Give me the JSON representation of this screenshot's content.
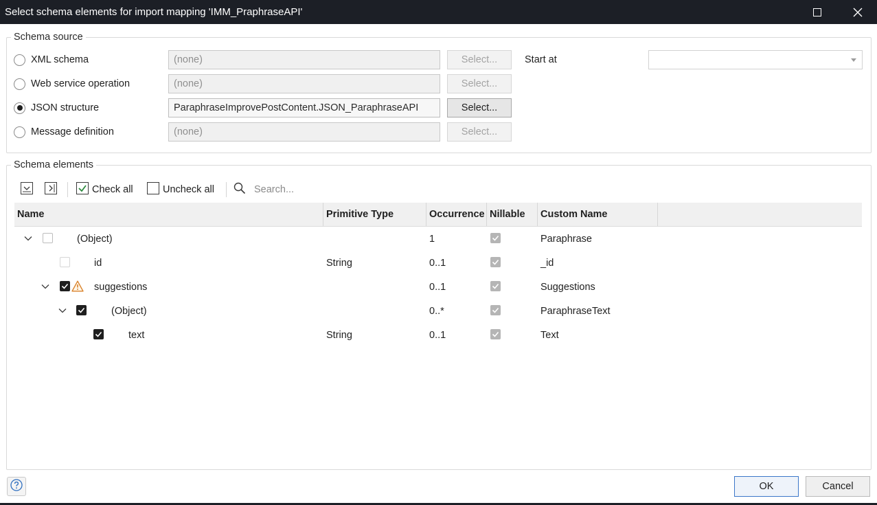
{
  "window": {
    "title": "Select schema elements for import mapping 'IMM_PraphraseAPI'"
  },
  "schema_source": {
    "legend": "Schema source",
    "options": [
      {
        "label": "XML schema",
        "value": "(none)",
        "button": "Select...",
        "selected": false
      },
      {
        "label": "Web service operation",
        "value": "(none)",
        "button": "Select...",
        "selected": false
      },
      {
        "label": "JSON structure",
        "value": "ParaphraseImprovePostContent.JSON_ParaphraseAPI",
        "button": "Select...",
        "selected": true
      },
      {
        "label": "Message definition",
        "value": "(none)",
        "button": "Select...",
        "selected": false
      }
    ],
    "start_at_label": "Start at",
    "start_at_value": ""
  },
  "schema_elements": {
    "legend": "Schema elements",
    "toolbar": {
      "check_all": "Check all",
      "uncheck_all": "Uncheck all",
      "search_placeholder": "Search..."
    },
    "columns": [
      "Name",
      "Primitive Type",
      "Occurrence",
      "Nillable",
      "Custom Name"
    ],
    "rows": [
      {
        "level": 0,
        "expanded": true,
        "checked": false,
        "warning": false,
        "name": "(Object)",
        "type": "",
        "occurrence": "1",
        "nillable": true,
        "custom_name": "Paraphrase"
      },
      {
        "level": 1,
        "expanded": null,
        "checked": false,
        "warning": false,
        "name": "id",
        "type": "String",
        "occurrence": "0..1",
        "nillable": true,
        "custom_name": "_id"
      },
      {
        "level": 1,
        "expanded": true,
        "checked": true,
        "warning": true,
        "name": "suggestions",
        "type": "",
        "occurrence": "0..1",
        "nillable": true,
        "custom_name": "Suggestions"
      },
      {
        "level": 2,
        "expanded": true,
        "checked": true,
        "warning": false,
        "name": "(Object)",
        "type": "",
        "occurrence": "0..*",
        "nillable": true,
        "custom_name": "ParaphraseText"
      },
      {
        "level": 3,
        "expanded": null,
        "checked": true,
        "warning": false,
        "name": "text",
        "type": "String",
        "occurrence": "0..1",
        "nillable": true,
        "custom_name": "Text"
      }
    ]
  },
  "footer": {
    "ok": "OK",
    "cancel": "Cancel"
  }
}
